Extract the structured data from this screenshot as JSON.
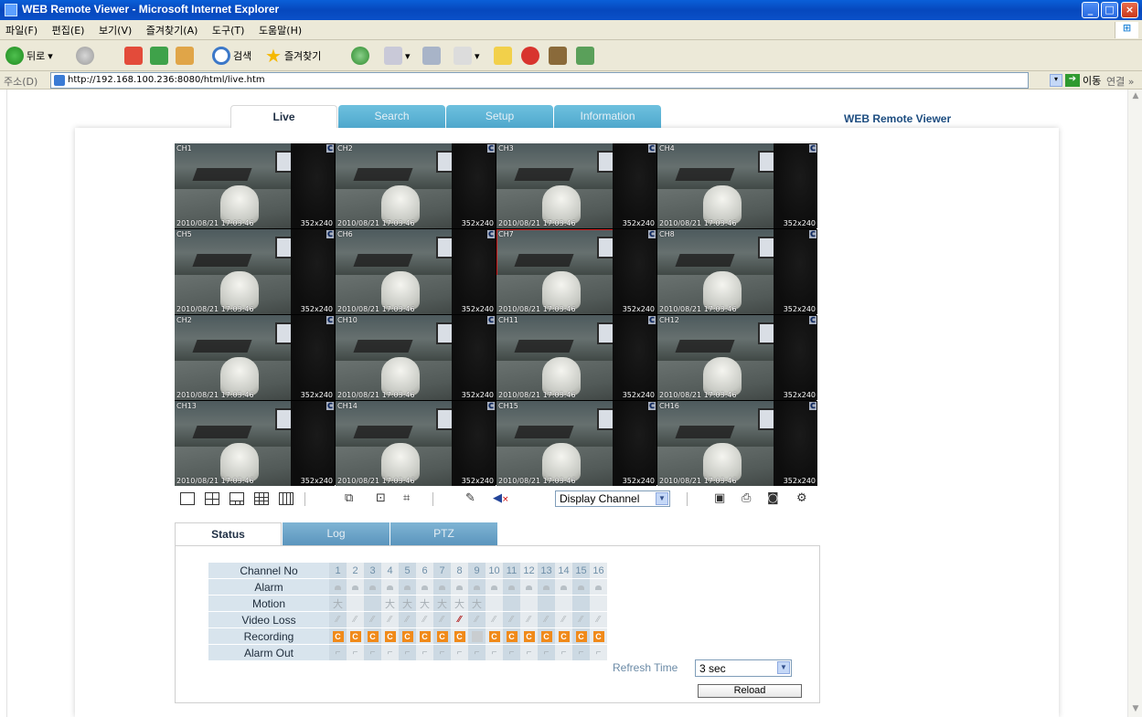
{
  "window": {
    "title": "WEB Remote Viewer - Microsoft Internet Explorer",
    "controls": [
      "_",
      "□",
      "×"
    ]
  },
  "menu": [
    "파일(F)",
    "편집(E)",
    "보기(V)",
    "즐겨찾기(A)",
    "도구(T)",
    "도움말(H)"
  ],
  "toolbar": {
    "back": "뒤로",
    "search": "검색",
    "favorites": "즐겨찾기"
  },
  "address": {
    "label": "주소(D)",
    "url": "http://192.168.100.236:8080/html/live.htm",
    "go": "이동",
    "links": "연결 »"
  },
  "brand": "WEB Remote Viewer",
  "tabs": [
    "Live",
    "Search",
    "Setup",
    "Information"
  ],
  "cameras": [
    {
      "ch": "CH1",
      "badge": "C",
      "datetime": "2010/08/21 17:03:46",
      "res": "352x240"
    },
    {
      "ch": "CH2",
      "badge": "C",
      "datetime": "2010/08/21 17:03:46",
      "res": "352x240"
    },
    {
      "ch": "CH3",
      "badge": "C",
      "datetime": "2010/08/21 17:03:46",
      "res": "352x240"
    },
    {
      "ch": "CH4",
      "badge": "C",
      "datetime": "2010/08/21 17:03:46",
      "res": "352x240"
    },
    {
      "ch": "CH5",
      "badge": "C",
      "datetime": "2010/08/21 17:03:46",
      "res": "352x240"
    },
    {
      "ch": "CH6",
      "badge": "C",
      "datetime": "2010/08/21 17:03:46",
      "res": "352x240"
    },
    {
      "ch": "CH7",
      "badge": "C",
      "datetime": "2010/08/21 17:03:46",
      "res": "352x240"
    },
    {
      "ch": "CH8",
      "badge": "C",
      "datetime": "2010/08/21 17:03:46",
      "res": "352x240"
    },
    {
      "ch": "CH2",
      "badge": "C",
      "datetime": "2010/08/21 17:03:46",
      "res": "352x240"
    },
    {
      "ch": "CH10",
      "badge": "C",
      "datetime": "2010/08/21 17:03:46",
      "res": "352x240"
    },
    {
      "ch": "CH11",
      "badge": "C",
      "datetime": "2010/08/21 17:03:46",
      "res": "352x240"
    },
    {
      "ch": "CH12",
      "badge": "C",
      "datetime": "2010/08/21 17:03:46",
      "res": "352x240"
    },
    {
      "ch": "CH13",
      "badge": "C",
      "datetime": "2010/08/21 17:03:46",
      "res": "352x240"
    },
    {
      "ch": "CH14",
      "badge": "C",
      "datetime": "2010/08/21 17:03:46",
      "res": "352x240"
    },
    {
      "ch": "CH15",
      "badge": "C",
      "datetime": "2010/08/21 17:03:46",
      "res": "352x240"
    },
    {
      "ch": "CH16",
      "badge": "C",
      "datetime": "2010/08/21 17:03:46",
      "res": "352x240"
    }
  ],
  "selected_channel": "CH7",
  "display_select": "Display Channel",
  "subtabs": [
    "Status",
    "Log",
    "PTZ"
  ],
  "status": {
    "rows": [
      "Channel No",
      "Alarm",
      "Motion",
      "Video Loss",
      "Recording",
      "Alarm Out"
    ],
    "channels": [
      "1",
      "2",
      "3",
      "4",
      "5",
      "6",
      "7",
      "8",
      "9",
      "10",
      "11",
      "12",
      "13",
      "14",
      "15",
      "16"
    ],
    "motion_active": [
      1,
      4,
      5,
      6,
      7,
      8,
      9
    ],
    "video_loss_active": [
      8
    ],
    "recording_idle": [
      8
    ]
  },
  "refresh": {
    "label": "Refresh Time",
    "value": "3 sec"
  },
  "reload_label": "Reload",
  "colors": {
    "tab_blue": "#4ea7cc",
    "record_orange": "#f08a1a",
    "brand": "#1d4d80",
    "xp_title": "#0648bd"
  }
}
